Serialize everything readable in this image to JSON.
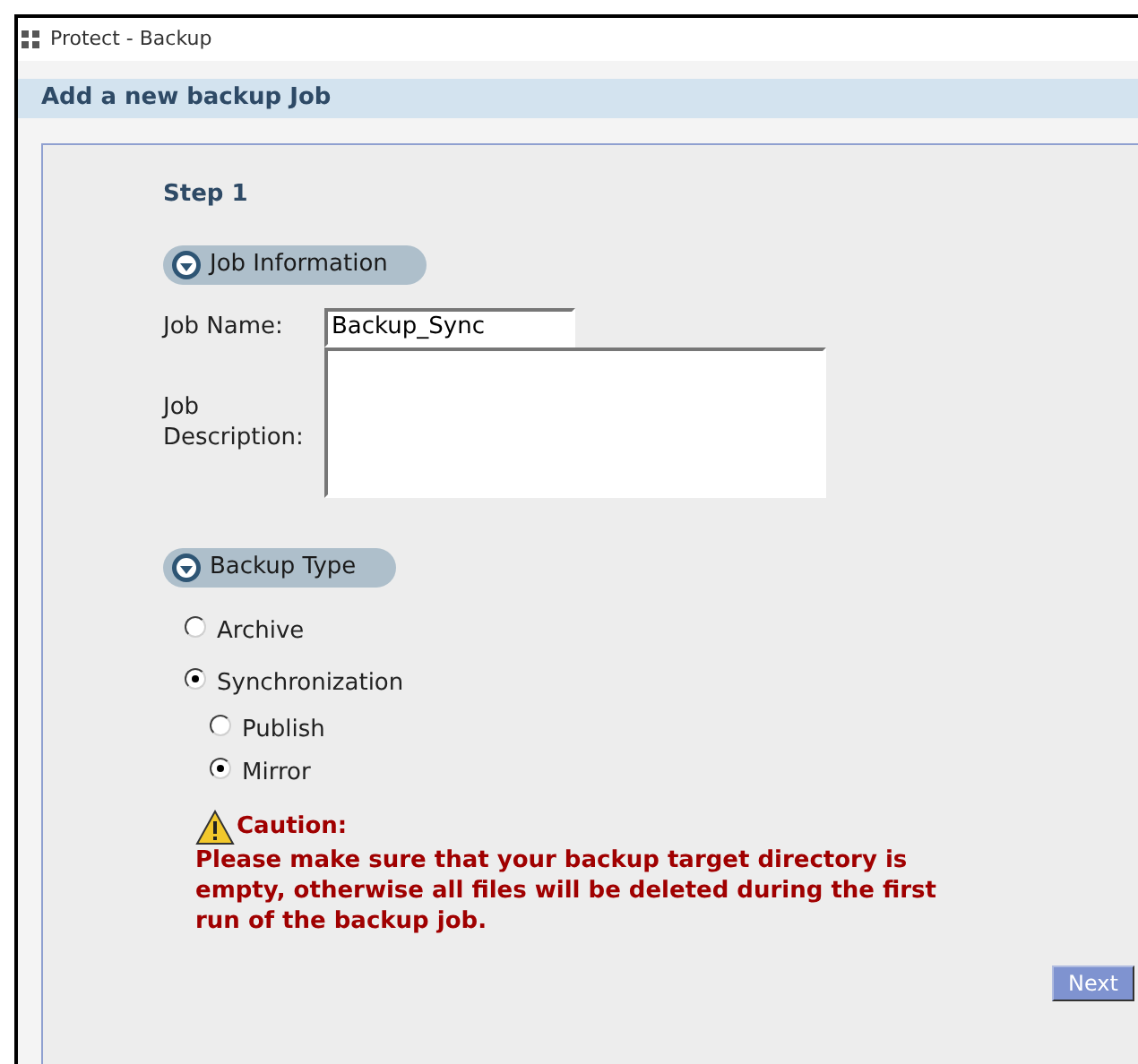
{
  "window": {
    "title": "Protect - Backup"
  },
  "header": "Add a new backup Job",
  "step": "Step 1",
  "job_information": {
    "title": "Job Information",
    "job_name": {
      "label": "Job Name:",
      "value": "Backup_Sync"
    },
    "job_description": {
      "label_lines": [
        "Job",
        "Description:"
      ]
    }
  },
  "backup_type": {
    "title": "Backup Type",
    "options": [
      {
        "label": "Archive",
        "selected": false
      },
      {
        "label": "Synchronization",
        "selected": true,
        "children": [
          {
            "label": "Publish",
            "selected": false
          },
          {
            "label": "Mirror",
            "selected": true
          }
        ]
      }
    ]
  },
  "caution": {
    "title": "Caution:",
    "message": "Please make sure that your backup target directory is empty, otherwise all files will be deleted during the first run of the backup job."
  },
  "buttons": [
    {
      "label": "Next"
    }
  ]
}
